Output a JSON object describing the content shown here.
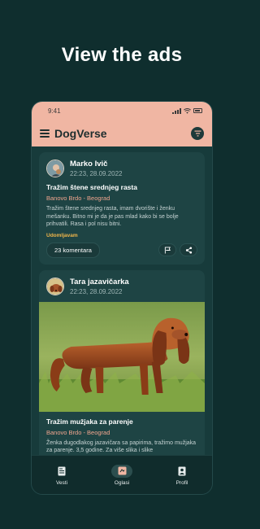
{
  "headline": "View the ads",
  "status": {
    "time": "9:41"
  },
  "app": {
    "title": "DogVerse"
  },
  "posts": [
    {
      "author": "Marko Ivič",
      "date": "22:23, 28.09.2022",
      "title": "Tražim štene srednjeg rasta",
      "location": "Banovo Brdo - Beograd",
      "description": "Tražim štene srednjeg rasta, imam dvorište i ženku mešanku. Bitno mi je da je pas mlad kako bi se bolje prihvatili. Rasa i pol nisu bitni.",
      "tag": "Udomljavam",
      "comments": "23 komentara"
    },
    {
      "author": "Tara jazavičarka",
      "date": "22:23, 28.09.2022",
      "title": "Tražim mužjaka za parenje",
      "location": "Banovo Brdo - Beograd",
      "description": "Ženka dugodlakog jazavičara sa papirima, tražimo mužjaka za parenje. 3,5 godine. Za više slika i slike"
    }
  ],
  "nav": [
    {
      "label": "Vesti",
      "icon": "news-icon",
      "active": false
    },
    {
      "label": "Oglasi",
      "icon": "ads-icon",
      "active": true
    },
    {
      "label": "Profil",
      "icon": "profile-icon",
      "active": false
    }
  ],
  "colors": {
    "background": "#0f2e2e",
    "topbar": "#f0b6a3",
    "card": "#1e4444",
    "accent": "#f0a58e",
    "tag": "#f1b64a"
  }
}
